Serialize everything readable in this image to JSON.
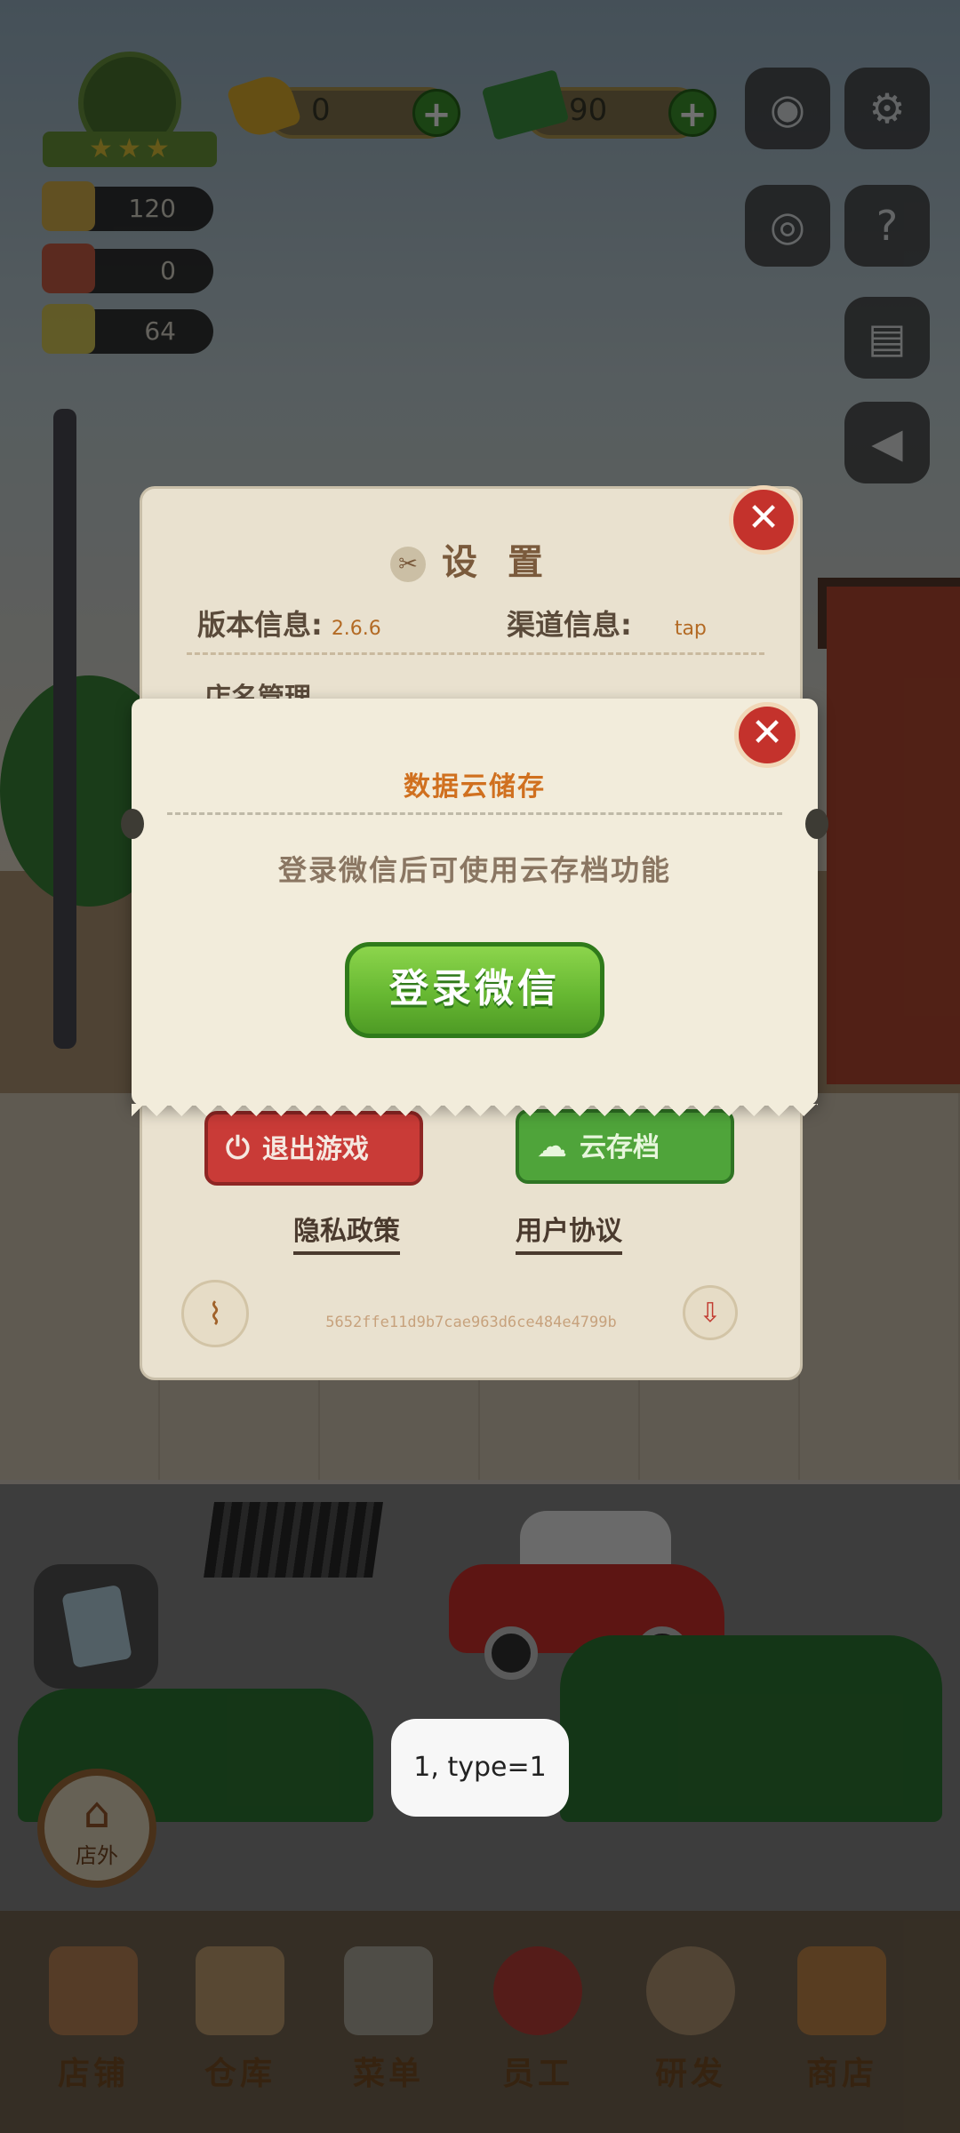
{
  "hud": {
    "gem_value": "0",
    "cash_value": "90",
    "plus_label": "+",
    "side_stats": [
      {
        "icon": "pot-icon",
        "value": "120"
      },
      {
        "icon": "chef-hat-icon",
        "value": "0"
      },
      {
        "icon": "book-icon",
        "value": "64"
      }
    ],
    "right_buttons": [
      "camera-icon",
      "gear-icon",
      "eye-icon",
      "help-book-icon",
      "recipe-book-icon",
      "megaphone-icon"
    ]
  },
  "settings": {
    "title": "设 置",
    "version_label": "版本信息:",
    "version_value": "2.6.6",
    "channel_label": "渠道信息:",
    "channel_value": "tap",
    "store_label": "店名管理",
    "exit_label": "退出游戏",
    "cloud_label": "云存档",
    "privacy_label": "隐私政策",
    "agreement_label": "用户协议",
    "uid": "5652ffe11d9b7cae963d6ce484e4799b",
    "close_label": "✕"
  },
  "dialog": {
    "title": "数据云储存",
    "message": "登录微信后可使用云存档功能",
    "button_label": "登录微信",
    "close_label": "✕"
  },
  "toast": {
    "text": "1, type=1"
  },
  "outside_button": {
    "label": "店外"
  },
  "bottom_nav": [
    {
      "label": "店铺",
      "icon": "shop-icon"
    },
    {
      "label": "仓库",
      "icon": "warehouse-icon"
    },
    {
      "label": "菜单",
      "icon": "menu-clipboard-icon"
    },
    {
      "label": "员工",
      "icon": "staff-icon"
    },
    {
      "label": "研发",
      "icon": "research-pot-icon"
    },
    {
      "label": "商店",
      "icon": "store-icon"
    }
  ]
}
